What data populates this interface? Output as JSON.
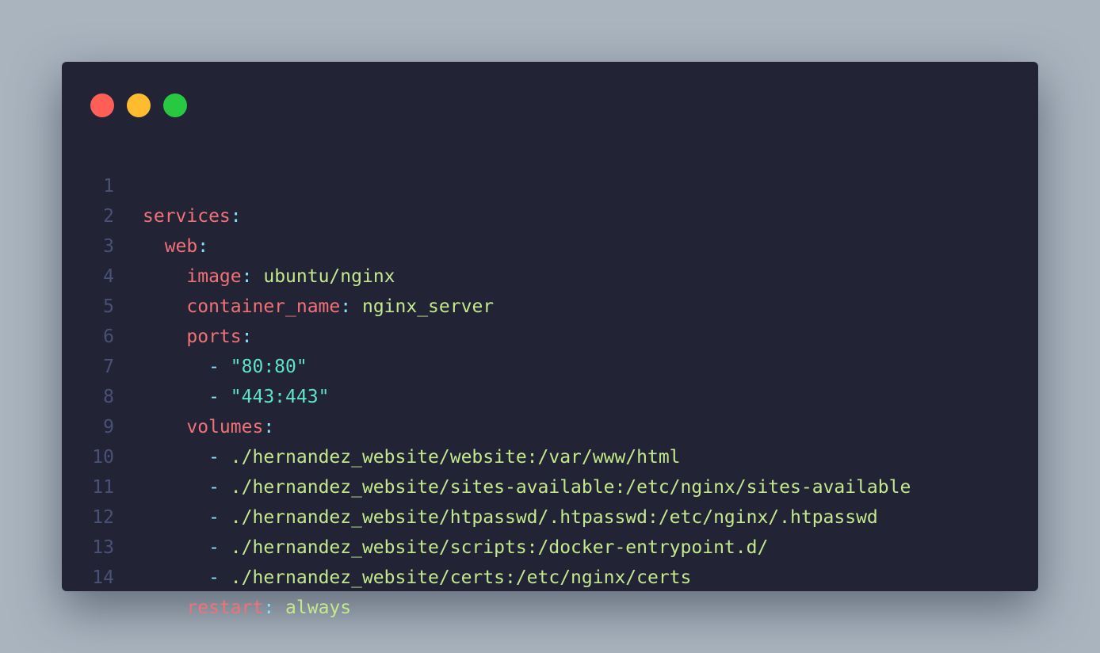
{
  "window": {
    "controls": {
      "close_color": "#ff5f57",
      "minimize_color": "#febc2e",
      "maximize_color": "#28c840"
    }
  },
  "colors": {
    "background": "#a9b4bf",
    "editor": "#222436",
    "line_number": "#495176",
    "key": "#f07178",
    "punctuation": "#86e1fc",
    "string": "#c3e88d",
    "quoted_string": "#5de4c7"
  },
  "code": {
    "lines": [
      {
        "n": "1",
        "indent": "",
        "key": "services",
        "colon": ":",
        "dash": "",
        "value": ""
      },
      {
        "n": "2",
        "indent": "  ",
        "key": "web",
        "colon": ":",
        "dash": "",
        "value": ""
      },
      {
        "n": "3",
        "indent": "    ",
        "key": "image",
        "colon": ": ",
        "dash": "",
        "value": "ubuntu/nginx"
      },
      {
        "n": "4",
        "indent": "    ",
        "key": "container_name",
        "colon": ": ",
        "dash": "",
        "value": "nginx_server"
      },
      {
        "n": "5",
        "indent": "    ",
        "key": "ports",
        "colon": ":",
        "dash": "",
        "value": ""
      },
      {
        "n": "6",
        "indent": "      ",
        "key": "",
        "colon": "",
        "dash": "- ",
        "value": "",
        "quoted": "\"80:80\""
      },
      {
        "n": "7",
        "indent": "      ",
        "key": "",
        "colon": "",
        "dash": "- ",
        "value": "",
        "quoted": "\"443:443\""
      },
      {
        "n": "8",
        "indent": "    ",
        "key": "volumes",
        "colon": ":",
        "dash": "",
        "value": ""
      },
      {
        "n": "9",
        "indent": "      ",
        "key": "",
        "colon": "",
        "dash": "- ",
        "value": "./hernandez_website/website:/var/www/html"
      },
      {
        "n": "10",
        "indent": "      ",
        "key": "",
        "colon": "",
        "dash": "- ",
        "value": "./hernandez_website/sites-available:/etc/nginx/sites-available"
      },
      {
        "n": "11",
        "indent": "      ",
        "key": "",
        "colon": "",
        "dash": "- ",
        "value": "./hernandez_website/htpasswd/.htpasswd:/etc/nginx/.htpasswd"
      },
      {
        "n": "12",
        "indent": "      ",
        "key": "",
        "colon": "",
        "dash": "- ",
        "value": "./hernandez_website/scripts:/docker-entrypoint.d/"
      },
      {
        "n": "13",
        "indent": "      ",
        "key": "",
        "colon": "",
        "dash": "- ",
        "value": "./hernandez_website/certs:/etc/nginx/certs"
      },
      {
        "n": "14",
        "indent": "    ",
        "key": "restart",
        "colon": ": ",
        "dash": "",
        "value": "always"
      }
    ]
  }
}
